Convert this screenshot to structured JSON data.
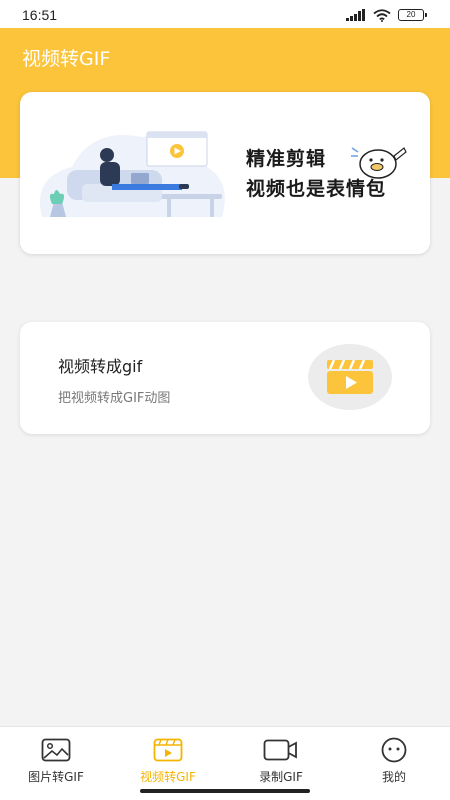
{
  "status_bar": {
    "time": "16:51",
    "battery": "20"
  },
  "header": {
    "title": "视频转GIF"
  },
  "banner": {
    "line1": "精准剪辑",
    "line2": "视频也是表情包"
  },
  "feature": {
    "title": "视频转成gif",
    "subtitle": "把视频转成GIF动图",
    "icon": "video-clapper-icon"
  },
  "tabs": [
    {
      "label": "图片转GIF",
      "icon": "image-icon",
      "active": false
    },
    {
      "label": "视频转GIF",
      "icon": "video-icon",
      "active": true
    },
    {
      "label": "录制GIF",
      "icon": "camera-icon",
      "active": false
    },
    {
      "label": "我的",
      "icon": "face-icon",
      "active": false
    }
  ],
  "colors": {
    "accent": "#fcc43a",
    "active_tab": "#f5b400",
    "background": "#f3f3f3"
  }
}
